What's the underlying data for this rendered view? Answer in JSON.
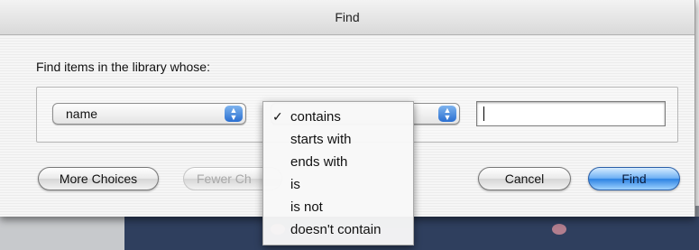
{
  "window": {
    "title": "Find"
  },
  "prompt": "Find items in the library whose:",
  "criteria": {
    "field_popup": {
      "value": "name"
    },
    "operator_menu": {
      "items": [
        {
          "label": "contains",
          "checked": true
        },
        {
          "label": "starts with",
          "checked": false
        },
        {
          "label": "ends with",
          "checked": false
        },
        {
          "label": "is",
          "checked": false
        },
        {
          "label": "is not",
          "checked": false
        },
        {
          "label": "doesn't contain",
          "checked": false
        }
      ],
      "check_mark": "✓"
    },
    "value_field": {
      "value": "",
      "placeholder": ""
    }
  },
  "buttons": {
    "more_choices": "More Choices",
    "fewer_choices": "Fewer Ch",
    "cancel": "Cancel",
    "find": "Find"
  },
  "colors": {
    "accent": "#2d83e3",
    "disabled_text": "#a8a8a8"
  }
}
